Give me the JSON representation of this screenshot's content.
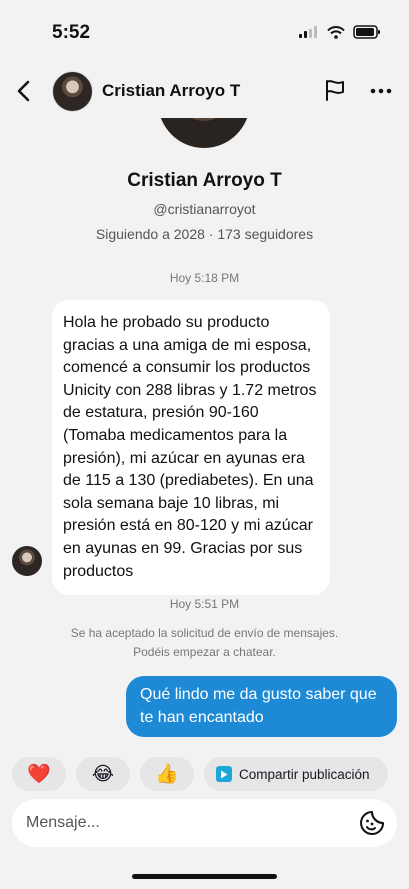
{
  "status_bar": {
    "time": "5:52"
  },
  "header": {
    "name": "Cristian Arroyo T",
    "back_icon": "chevron-left-icon",
    "flag_icon": "flag-icon",
    "more_icon": "more-horizontal-icon"
  },
  "profile": {
    "name": "Cristian Arroyo T",
    "handle": "@cristianarroyot",
    "stats": "Siguiendo a 2028 · 173 seguidores"
  },
  "conversation": {
    "timestamp_1": "Hoy 5:18 PM",
    "incoming_message": "Hola he probado su producto gracias a una amiga de mi esposa, comencé a consumir los productos Unicity con 288 libras y 1.72 metros de estatura, presión 90-160 (Tomaba medicamentos para la presión), mi azúcar en ayunas era de 115 a 130 (prediabetes). En una sola semana baje 10 libras, mi presión está en 80-120 y mi azúcar en ayunas en 99. Gracias por sus productos",
    "timestamp_2": "Hoy 5:51 PM",
    "system_line_1": "Se ha aceptado la solicitud de envío de mensajes.",
    "system_line_2": "Podéis empezar a chatear.",
    "outgoing_message": "Qué lindo me da gusto saber que te han encantado"
  },
  "quick_actions": {
    "heart": "❤️",
    "laugh": "😂",
    "thumbs_up": "👍",
    "share_label": "Compartir publicación"
  },
  "composer": {
    "placeholder": "Mensaje...",
    "value": ""
  },
  "colors": {
    "background": "#f2f2f2",
    "outgoing_bubble": "#1e8ad6",
    "incoming_bubble": "#ffffff"
  }
}
